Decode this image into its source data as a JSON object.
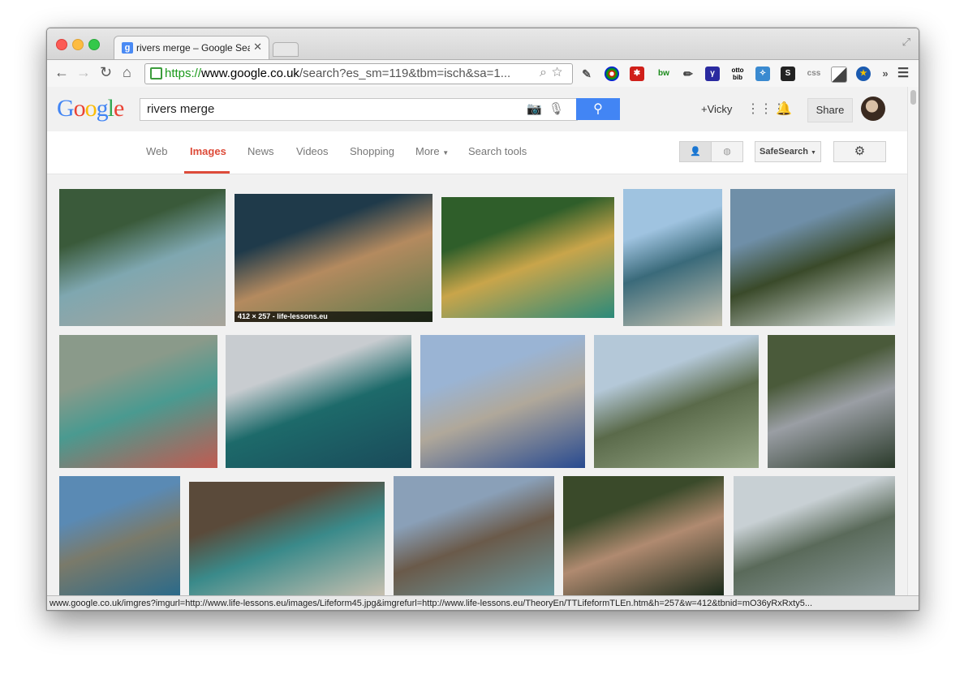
{
  "browser": {
    "tab_title": "rivers merge – Google Sear",
    "tab_favicon": "g",
    "url_scheme": "https://",
    "url_host": "www.google.co.uk",
    "url_rest": "/search?es_sm=119&tbm=isch&sa=1...",
    "nav_icons": [
      "back-icon",
      "forward-icon",
      "reload-icon",
      "home-icon"
    ],
    "extensions": [
      "eyedropper-icon",
      "colorzilla-icon",
      "lastpass-icon",
      "bw",
      "pencil-icon",
      "gamma-icon",
      "otto bib",
      "dna-icon",
      "s-icon",
      "css",
      "pixel-icon",
      "star-icon",
      "»"
    ]
  },
  "google": {
    "logo": [
      "G",
      "o",
      "o",
      "g",
      "l",
      "e"
    ],
    "logo_colors": [
      "#4285f4",
      "#ea4335",
      "#fbbc05",
      "#4285f4",
      "#34a853",
      "#ea4335"
    ],
    "query": "rivers merge",
    "user": "+Vicky",
    "share_label": "Share"
  },
  "nav": {
    "tabs": [
      "Web",
      "Images",
      "News",
      "Videos",
      "Shopping",
      "More",
      "Search tools"
    ],
    "active": "Images",
    "safesearch": "SafeSearch"
  },
  "results": {
    "caption": "412 × 257 - life-lessons.eu",
    "images": [
      {
        "alt": "river bank with turquoise water",
        "colors": [
          "#3a5a3a",
          "#7fa7b0",
          "#a9a59b"
        ]
      },
      {
        "alt": "dark and muddy rivers merging",
        "colors": [
          "#1f3a4a",
          "#b48a5f",
          "#5a7a4a"
        ]
      },
      {
        "alt": "yellow and green streams",
        "colors": [
          "#2f5e2a",
          "#c9a54a",
          "#2b8a7a"
        ]
      },
      {
        "alt": "river split under sky",
        "colors": [
          "#9fc3e0",
          "#3a6a7a",
          "#c6c2b0"
        ]
      },
      {
        "alt": "waterfall in green valley",
        "colors": [
          "#6f8fa8",
          "#3a4a2a",
          "#e8eef0"
        ]
      },
      {
        "alt": "red viewing platform over river",
        "colors": [
          "#8a9a8a",
          "#4a9a90",
          "#c25a50"
        ]
      },
      {
        "alt": "sea meeting line",
        "colors": [
          "#c8ccd0",
          "#1d6a6a",
          "#1a4a5a"
        ]
      },
      {
        "alt": "blue water and sand",
        "colors": [
          "#9ab4d4",
          "#b0a89a",
          "#284a90"
        ]
      },
      {
        "alt": "town along river valley",
        "colors": [
          "#b4c8d8",
          "#5a6a4a",
          "#9aaa8a"
        ]
      },
      {
        "alt": "stream through forest",
        "colors": [
          "#4a5a3a",
          "#9a9ea4",
          "#2a3a2a"
        ]
      },
      {
        "alt": "city at river confluence",
        "colors": [
          "#5a8ab4",
          "#7a7a6a",
          "#2a6a8a"
        ]
      },
      {
        "alt": "rocky riverbank",
        "colors": [
          "#5a4a3a",
          "#3a8a8a",
          "#c8c0b0"
        ]
      },
      {
        "alt": "mountain river valley",
        "colors": [
          "#8aa0b8",
          "#6a5a4a",
          "#6a9aa0"
        ]
      },
      {
        "alt": "hand holding fish",
        "colors": [
          "#3a4a2a",
          "#b08a70",
          "#1a2a1a"
        ]
      },
      {
        "alt": "misty river valley",
        "colors": [
          "#c8d0d4",
          "#5a6a5a",
          "#8a9a9a"
        ]
      }
    ]
  },
  "status_url": "www.google.co.uk/imgres?imgurl=http://www.life-lessons.eu/images/Lifeform45.jpg&imgrefurl=http://www.life-lessons.eu/TheoryEn/TTLifeformTLEn.htm&h=257&w=412&tbnid=mO36yRxRxty5..."
}
